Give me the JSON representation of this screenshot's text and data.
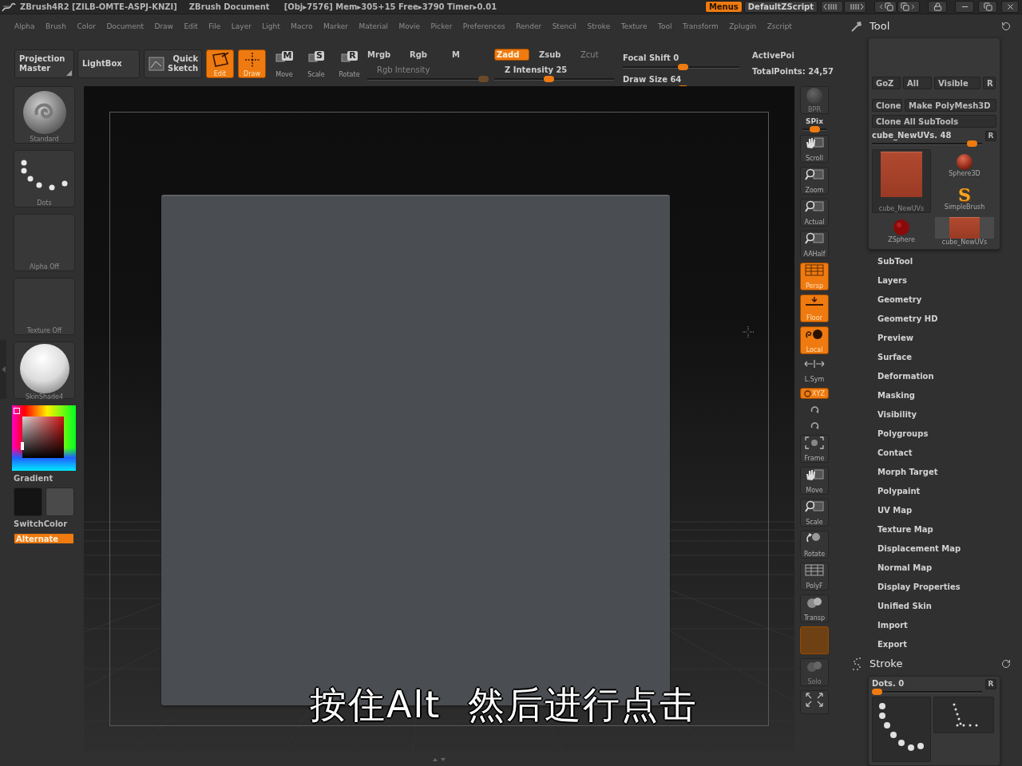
{
  "title_bar": {
    "app": "ZBrush4R2 [ZILB-OMTE-ASPJ-KNZI]",
    "document": "ZBrush Document",
    "stats": "[Obj▸7576] Mem▸305+15 Free▸3790 Timer▸0.01",
    "menus": {
      "label": "Menus",
      "on": true
    },
    "script": "DefaultZScript"
  },
  "menu_bar": [
    "Alpha",
    "Brush",
    "Color",
    "Document",
    "Draw",
    "Edit",
    "File",
    "Layer",
    "Light",
    "Macro",
    "Marker",
    "Material",
    "Movie",
    "Picker",
    "Preferences",
    "Render",
    "Stencil",
    "Stroke",
    "Texture",
    "Tool",
    "Transform",
    "Zplugin",
    "Zscript"
  ],
  "toolbar": {
    "buttons": [
      {
        "kind": "popup",
        "label": "Projection Master"
      },
      {
        "kind": "text",
        "label": "LightBox"
      },
      {
        "kind": "sketch",
        "label": "Quick Sketch"
      }
    ],
    "modes": [
      {
        "kind": "edit",
        "label": "Edit",
        "on": true
      },
      {
        "kind": "draw",
        "label": "Draw",
        "on": true
      },
      {
        "kind": "move",
        "key": "M",
        "label": "Move",
        "on": false
      },
      {
        "kind": "scale",
        "key": "S",
        "label": "Scale",
        "on": false
      },
      {
        "kind": "rotate",
        "key": "R",
        "label": "Rotate",
        "on": false
      }
    ],
    "channels": [
      {
        "label": "Mrgb",
        "on": false
      },
      {
        "label": "Rgb",
        "on": false
      },
      {
        "label": "M",
        "on": false
      }
    ],
    "rgb_intensity": {
      "label": "Rgb Intensity",
      "disabled": true,
      "level": 1
    },
    "depth": [
      {
        "label": "Zadd",
        "on": true,
        "disabled": false
      },
      {
        "label": "Zsub",
        "on": false,
        "disabled": false
      },
      {
        "label": "Zcut",
        "on": false,
        "disabled": true
      }
    ],
    "z_intensity": {
      "label": "Z Intensity 25",
      "level": 0.45
    },
    "sliders": [
      {
        "label": "Focal Shift 0",
        "level": 0.52
      },
      {
        "label": "Draw Size 64",
        "level": 0.52
      }
    ],
    "points": [
      "ActivePoi",
      "TotalPoints: 24,57"
    ]
  },
  "left_shelf": {
    "tiles": [
      {
        "kind": "brush",
        "label": "Standard"
      },
      {
        "kind": "stroke",
        "label": "Dots"
      },
      {
        "kind": "empty",
        "label": "Alpha Off"
      },
      {
        "kind": "empty",
        "label": "Texture Off"
      },
      {
        "kind": "material",
        "label": "SkinShade4"
      }
    ],
    "gradient": "Gradient",
    "swatches": [
      {
        "color": "#141414"
      },
      {
        "color": "#4a4a4a"
      }
    ],
    "switch_color": "SwitchColor",
    "alternate": {
      "label": "Alternate",
      "on": true
    }
  },
  "canvas": {
    "subtitle": "按住Alt  然后进行点击"
  },
  "right_toolbar": {
    "bpr": {
      "label": "BPR",
      "disabled": true
    },
    "spix": {
      "label": "SPix",
      "level": 0.5
    },
    "buttons": [
      {
        "kind": "scroll",
        "label": "Scroll",
        "on": false,
        "disabled": false
      },
      {
        "kind": "zoom",
        "label": "Zoom",
        "on": false,
        "disabled": false
      },
      {
        "kind": "actual",
        "label": "Actual",
        "on": false,
        "disabled": false
      },
      {
        "kind": "aahalf",
        "label": "AAHalf",
        "on": false,
        "disabled": false
      },
      {
        "kind": "persp",
        "label": "Persp",
        "on": true,
        "disabled": false
      },
      {
        "kind": "floor",
        "label": "Floor",
        "on": true,
        "disabled": false
      },
      {
        "kind": "local",
        "label": "Local",
        "on": true,
        "disabled": false
      },
      {
        "kind": "lsym",
        "label": "L.Sym",
        "on": false,
        "disabled": false
      },
      {
        "kind": "xyz",
        "label": "XYZ",
        "on": true,
        "disabled": false
      },
      {
        "kind": "roty",
        "on": false,
        "disabled": false
      },
      {
        "kind": "rotz",
        "on": false,
        "disabled": false
      },
      {
        "kind": "frame",
        "label": "Frame",
        "on": false,
        "disabled": false
      },
      {
        "kind": "move",
        "label": "Move",
        "on": false,
        "disabled": false
      },
      {
        "kind": "scale",
        "label": "Scale",
        "on": false,
        "disabled": false
      },
      {
        "kind": "rotate",
        "label": "Rotate",
        "on": false,
        "disabled": false
      },
      {
        "kind": "polyf",
        "label": "PolyF",
        "on": false,
        "disabled": false
      },
      {
        "kind": "transp",
        "label": "Transp",
        "on": false,
        "disabled": false
      },
      {
        "kind": "ghost",
        "on": true,
        "disabled": true
      },
      {
        "kind": "solo",
        "label": "Solo",
        "on": false,
        "disabled": true
      },
      {
        "kind": "xpose",
        "on": false,
        "disabled": false
      }
    ]
  },
  "tool_panel": {
    "title": "Tool",
    "rows": [
      {
        "buttons": [
          {
            "label": "GoZ"
          },
          {
            "label": "All"
          },
          {
            "label": "Visible"
          },
          {
            "label": "R"
          }
        ]
      },
      {
        "buttons": [
          {
            "label": "Clone"
          },
          {
            "label": "Make PolyMesh3D"
          }
        ]
      },
      {
        "buttons": [
          {
            "label": "Clone All SubTools"
          }
        ]
      }
    ],
    "current": {
      "label": "cube_NewUVs. 48",
      "level": 0.95,
      "reset": "R"
    },
    "current_tool": {
      "kind": "cube",
      "label": "cube_NewUVs"
    },
    "thumbnails": [
      {
        "kind": "sphere",
        "label": "Sphere3D"
      },
      {
        "kind": "glyph",
        "glyph": "S",
        "label": "SimpleBrush"
      },
      {
        "kind": "zsphere",
        "label": "ZSphere"
      },
      {
        "kind": "cube",
        "label": "cube_NewUVs"
      }
    ],
    "subpalettes": [
      "SubTool",
      "Layers",
      "Geometry",
      "Geometry HD",
      "Preview",
      "Surface",
      "Deformation",
      "Masking",
      "Visibility",
      "Polygroups",
      "Contact",
      "Morph Target",
      "Polypaint",
      "UV Map",
      "Texture Map",
      "Displacement Map",
      "Normal Map",
      "Display Properties",
      "Unified Skin",
      "Import",
      "Export"
    ]
  },
  "stroke_panel": {
    "title": "Stroke",
    "slider": {
      "label": "Dots. 0",
      "level": 0,
      "reset": "R"
    },
    "thumbnails": [
      {
        "kind": "dots"
      },
      {
        "kind": "dot_line"
      }
    ]
  }
}
